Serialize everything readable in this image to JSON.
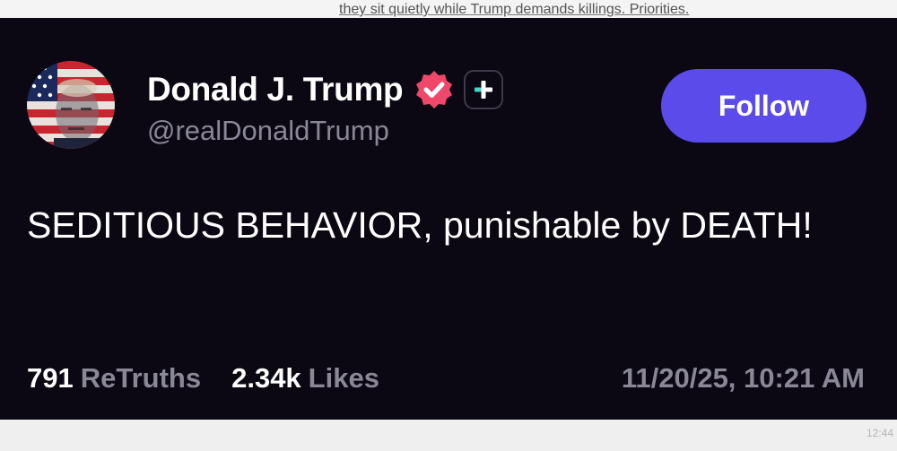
{
  "background_caption": "they sit quietly while Trump demands killings. Priorities.",
  "corner_text": "12:44",
  "post": {
    "author": {
      "display_name": "Donald J. Trump",
      "handle": "@realDonaldTrump",
      "verified_icon": "verified-badge-icon",
      "extra_badge_icon": "plus-badge-icon",
      "avatar": "profile-photo-avatar"
    },
    "follow_label": "Follow",
    "text": "SEDITIOUS BEHAVIOR, punishable by DEATH!",
    "stats": {
      "retruths_count": "791",
      "retruths_label": "ReTruths",
      "likes_count": "2.34k",
      "likes_label": "Likes"
    },
    "timestamp": "11/20/25, 10:21 AM"
  },
  "colors": {
    "card_background": "#0b0814",
    "accent_button": "#5a4bea",
    "verified_pink": "#f0486b",
    "muted_text": "#8a8797",
    "primary_text": "#ffffff",
    "plus_badge_teal": "#3fd6c4"
  }
}
